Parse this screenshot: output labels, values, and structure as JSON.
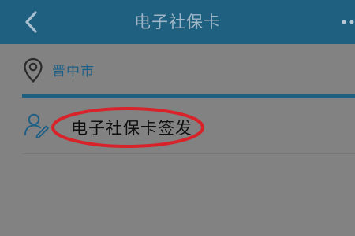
{
  "header": {
    "title": "电子社保卡",
    "back_icon": "chevron-left-icon",
    "more_icon": "more-dots-icon"
  },
  "location": {
    "icon": "location-pin-icon",
    "city": "晋中市"
  },
  "service": {
    "icon": "user-edit-icon",
    "label": "电子社保卡签发"
  },
  "colors": {
    "header_bg": "#1f5f80",
    "accent": "#1e5f86",
    "overlay": "#828282",
    "highlight": "#d8232a"
  }
}
